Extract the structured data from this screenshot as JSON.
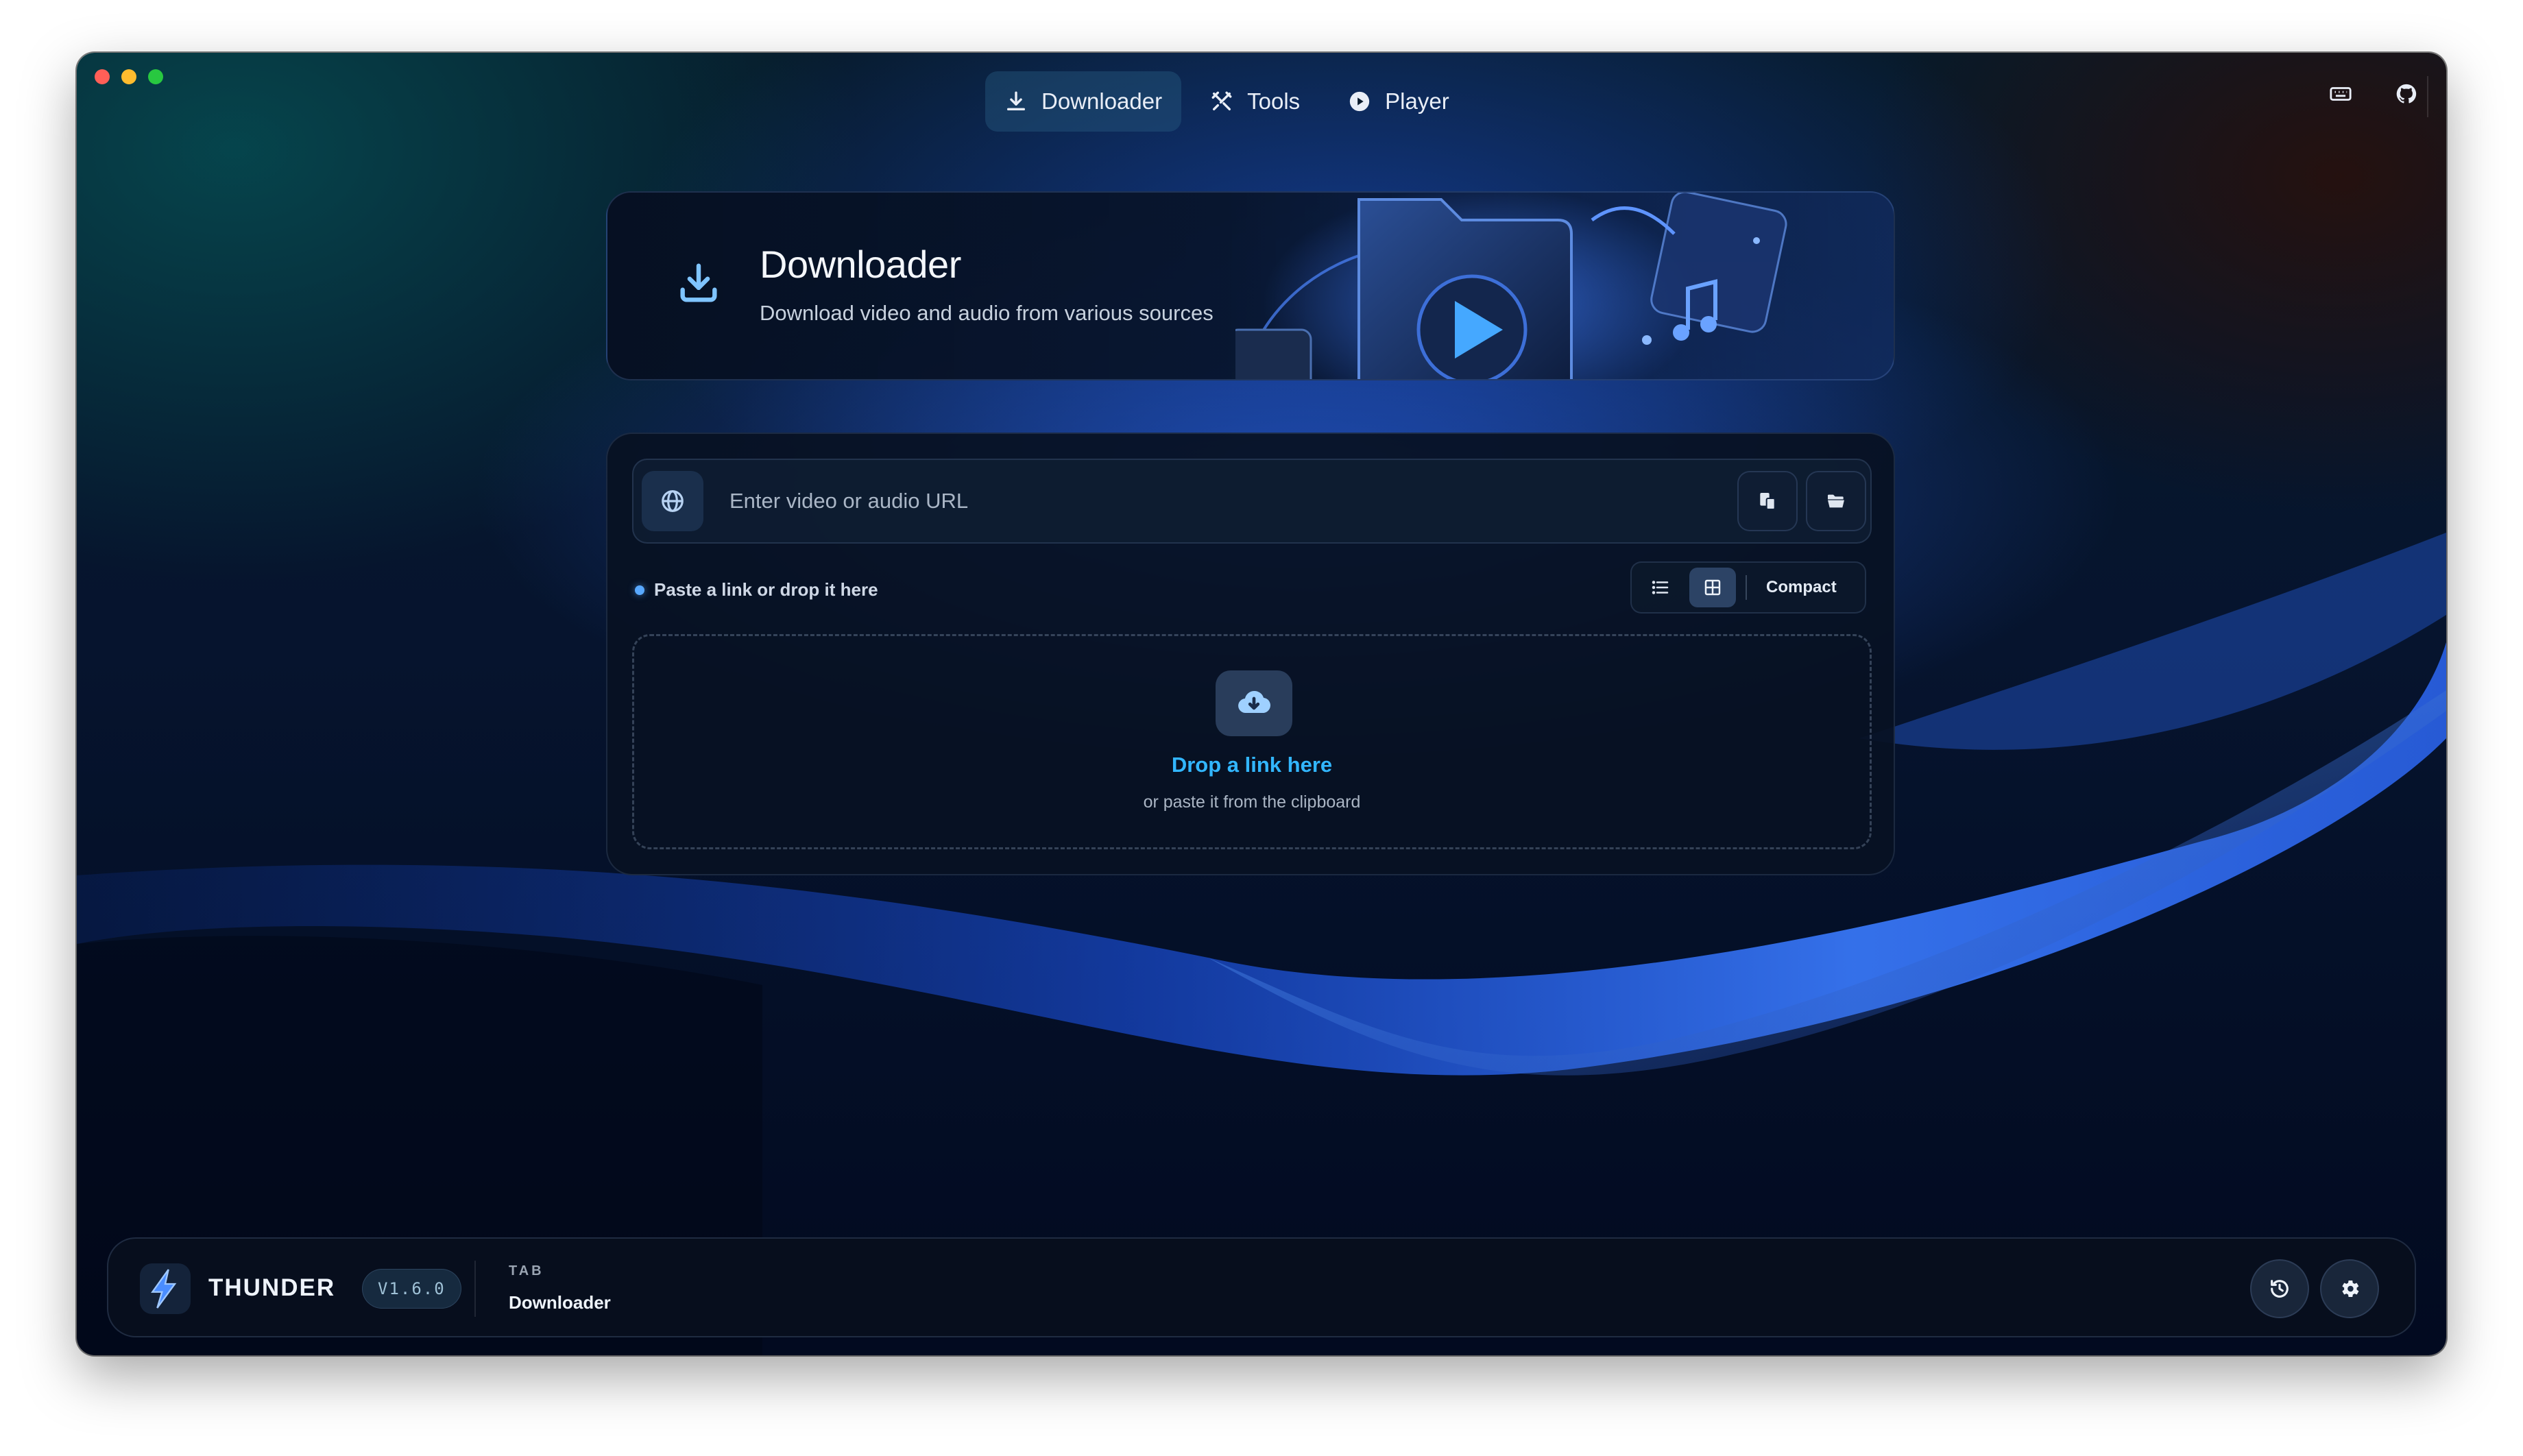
{
  "nav": {
    "tabs": [
      {
        "label": "Downloader",
        "icon": "download-icon",
        "active": true
      },
      {
        "label": "Tools",
        "icon": "tools-icon",
        "active": false
      },
      {
        "label": "Player",
        "icon": "play-circle-icon",
        "active": false
      }
    ],
    "right_icons": [
      "keyboard-icon",
      "github-icon"
    ]
  },
  "hero": {
    "title": "Downloader",
    "subtitle": "Download video and audio from various sources",
    "icon": "download-icon"
  },
  "url_bar": {
    "value": "",
    "placeholder": "Enter video or audio URL",
    "icons": [
      "globe-icon",
      "clipboard-paste-icon",
      "folder-open-icon"
    ]
  },
  "status": {
    "text": "Paste a link or drop it here"
  },
  "view_toggle": {
    "options": [
      "list-icon",
      "grid-icon"
    ],
    "selected": "grid-icon",
    "label": "Compact"
  },
  "drop_zone": {
    "title": "Drop a link here",
    "subtitle": "or paste it from the clipboard",
    "icon": "cloud-download-icon"
  },
  "footer": {
    "brand": "THUNDER",
    "version": "V1.6.0",
    "tab_label": "TAB",
    "tab_value": "Downloader",
    "buttons": [
      "history-icon",
      "settings-gear-icon"
    ]
  },
  "colors": {
    "accent": "#32b6ff",
    "status_dot": "#58a8ff",
    "window_bg": "#06142e"
  }
}
